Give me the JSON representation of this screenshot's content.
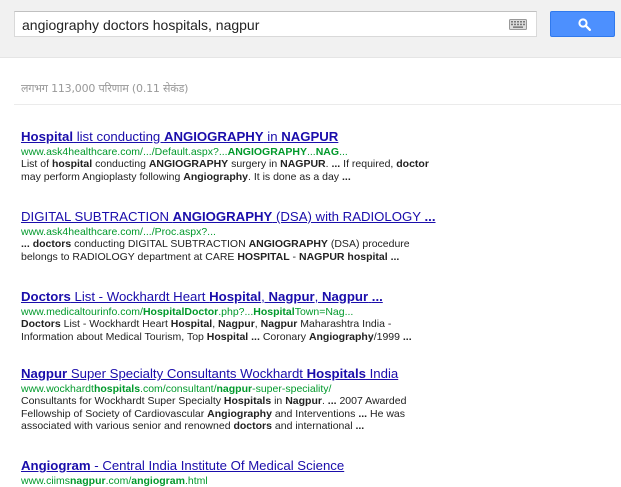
{
  "search": {
    "query": "angiography doctors hospitals, nagpur"
  },
  "stats": "लगभग 113,000 परिणाम (0.11 सेकंड)",
  "colors": {
    "link": "#1a0dab",
    "url": "#00992b",
    "button": "#4d90fe"
  },
  "results": [
    {
      "title": [
        {
          "t": "Hospital",
          "b": true
        },
        {
          "t": " list conducting ",
          "b": false
        },
        {
          "t": "ANGIOGRAPHY",
          "b": true
        },
        {
          "t": " in ",
          "b": false
        },
        {
          "t": "NAGPUR",
          "b": true
        }
      ],
      "url": [
        {
          "t": "www.ask4healthcare.com/.../Default.aspx?...",
          "b": false
        },
        {
          "t": "ANGIOGRAPHY",
          "b": true
        },
        {
          "t": "...",
          "b": false
        },
        {
          "t": "NAG",
          "b": true
        },
        {
          "t": "...",
          "b": false
        }
      ],
      "snippet": [
        [
          {
            "t": "List of ",
            "b": false
          },
          {
            "t": "hospital",
            "b": true
          },
          {
            "t": " conducting ",
            "b": false
          },
          {
            "t": "ANGIOGRAPHY",
            "b": true
          },
          {
            "t": " surgery in ",
            "b": false
          },
          {
            "t": "NAGPUR",
            "b": true
          },
          {
            "t": ". ",
            "b": false
          },
          {
            "t": "...",
            "b": true
          },
          {
            "t": " If required, ",
            "b": false
          },
          {
            "t": "doctor",
            "b": true
          }
        ],
        [
          {
            "t": "may perform Angioplasty following ",
            "b": false
          },
          {
            "t": "Angiography",
            "b": true
          },
          {
            "t": ". It is done as a day ",
            "b": false
          },
          {
            "t": "...",
            "b": true
          }
        ]
      ]
    },
    {
      "title": [
        {
          "t": "DIGITAL SUBTRACTION ",
          "b": false
        },
        {
          "t": "ANGIOGRAPHY",
          "b": true
        },
        {
          "t": " (DSA) with RADIOLOGY ",
          "b": false
        },
        {
          "t": "...",
          "b": true
        }
      ],
      "url": [
        {
          "t": "www.ask4healthcare.com/.../Proc.aspx?...",
          "b": false
        }
      ],
      "snippet": [
        [
          {
            "t": "...",
            "b": true
          },
          {
            "t": " ",
            "b": false
          },
          {
            "t": "doctors",
            "b": true
          },
          {
            "t": " conducting DIGITAL SUBTRACTION ",
            "b": false
          },
          {
            "t": "ANGIOGRAPHY",
            "b": true
          },
          {
            "t": " (DSA) procedure",
            "b": false
          }
        ],
        [
          {
            "t": "belongs to RADIOLOGY department at CARE ",
            "b": false
          },
          {
            "t": "HOSPITAL",
            "b": true
          },
          {
            "t": " - ",
            "b": false
          },
          {
            "t": "NAGPUR hospital",
            "b": true
          },
          {
            "t": " ",
            "b": false
          },
          {
            "t": "...",
            "b": true
          }
        ]
      ]
    },
    {
      "title": [
        {
          "t": "Doctors",
          "b": true
        },
        {
          "t": " List - Wockhardt Heart ",
          "b": false
        },
        {
          "t": "Hospital",
          "b": true
        },
        {
          "t": ", ",
          "b": false
        },
        {
          "t": "Nagpur",
          "b": true
        },
        {
          "t": ", ",
          "b": false
        },
        {
          "t": "Nagpur",
          "b": true
        },
        {
          "t": " ",
          "b": false
        },
        {
          "t": "...",
          "b": true
        }
      ],
      "url": [
        {
          "t": "www.medicaltourinfo.com/",
          "b": false
        },
        {
          "t": "HospitalDoctor",
          "b": true
        },
        {
          "t": ".php?...",
          "b": false
        },
        {
          "t": "Hospital",
          "b": true
        },
        {
          "t": "Town=Nag...",
          "b": false
        }
      ],
      "snippet": [
        [
          {
            "t": "Doctors",
            "b": true
          },
          {
            "t": " List - Wockhardt Heart ",
            "b": false
          },
          {
            "t": "Hospital",
            "b": true
          },
          {
            "t": ", ",
            "b": false
          },
          {
            "t": "Nagpur",
            "b": true
          },
          {
            "t": ", ",
            "b": false
          },
          {
            "t": "Nagpur",
            "b": true
          },
          {
            "t": " Maharashtra India -",
            "b": false
          }
        ],
        [
          {
            "t": "Information about Medical Tourism, Top ",
            "b": false
          },
          {
            "t": "Hospital",
            "b": true
          },
          {
            "t": " ",
            "b": false
          },
          {
            "t": "...",
            "b": true
          },
          {
            "t": " Coronary ",
            "b": false
          },
          {
            "t": "Angiography",
            "b": true
          },
          {
            "t": "/1999 ",
            "b": false
          },
          {
            "t": "...",
            "b": true
          }
        ]
      ]
    },
    {
      "title": [
        {
          "t": "Nagpur",
          "b": true
        },
        {
          "t": " Super Specialty Consultants Wockhardt ",
          "b": false
        },
        {
          "t": "Hospitals",
          "b": true
        },
        {
          "t": " India",
          "b": false
        }
      ],
      "url": [
        {
          "t": "www.wockhardt",
          "b": false
        },
        {
          "t": "hospitals",
          "b": true
        },
        {
          "t": ".com/consultant/",
          "b": false
        },
        {
          "t": "nagpur",
          "b": true
        },
        {
          "t": "-super-speciality/",
          "b": false
        }
      ],
      "snippet": [
        [
          {
            "t": "Consultants for Wockhardt Super Specialty ",
            "b": false
          },
          {
            "t": "Hospitals",
            "b": true
          },
          {
            "t": " in ",
            "b": false
          },
          {
            "t": "Nagpur",
            "b": true
          },
          {
            "t": ". ",
            "b": false
          },
          {
            "t": "...",
            "b": true
          },
          {
            "t": " 2007 Awarded",
            "b": false
          }
        ],
        [
          {
            "t": "Fellowship of Society of Cardiovascular ",
            "b": false
          },
          {
            "t": "Angiography",
            "b": true
          },
          {
            "t": " and Interventions ",
            "b": false
          },
          {
            "t": "...",
            "b": true
          },
          {
            "t": " He was",
            "b": false
          }
        ],
        [
          {
            "t": "associated with various senior and renowned ",
            "b": false
          },
          {
            "t": "doctors",
            "b": true
          },
          {
            "t": " and international ",
            "b": false
          },
          {
            "t": "...",
            "b": true
          }
        ]
      ]
    },
    {
      "title": [
        {
          "t": "Angiogram",
          "b": true
        },
        {
          "t": " - Central India Institute Of Medical Science",
          "b": false
        }
      ],
      "url": [
        {
          "t": "www.ciims",
          "b": false
        },
        {
          "t": "nagpur",
          "b": true
        },
        {
          "t": ".com/",
          "b": false
        },
        {
          "t": "angiogram",
          "b": true
        },
        {
          "t": ".html",
          "b": false
        }
      ],
      "snippet": []
    }
  ]
}
